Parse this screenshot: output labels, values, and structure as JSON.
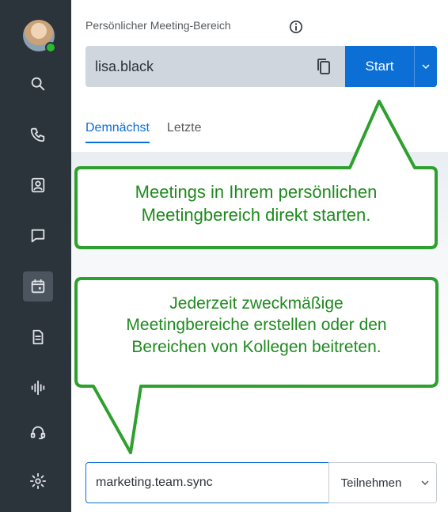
{
  "sidebar": {
    "items": [
      {
        "name": "search",
        "icon": "search-icon"
      },
      {
        "name": "calls",
        "icon": "phone-icon"
      },
      {
        "name": "contacts",
        "icon": "contacts-icon"
      },
      {
        "name": "messaging",
        "icon": "chat-icon"
      },
      {
        "name": "meetings",
        "icon": "calendar-icon",
        "active": true
      },
      {
        "name": "voicemail",
        "icon": "document-icon"
      },
      {
        "name": "analytics",
        "icon": "waveform-icon"
      },
      {
        "name": "help",
        "icon": "headset-icon"
      },
      {
        "name": "settings",
        "icon": "gear-icon"
      }
    ],
    "presence_color": "#2eb82e"
  },
  "pmr": {
    "title": "Persönlicher Meeting-Bereich",
    "name": "lisa.black",
    "start_label": "Start"
  },
  "tabs": [
    {
      "label": "Demnächst",
      "active": true
    },
    {
      "label": "Letzte",
      "active": false
    }
  ],
  "join": {
    "value": "marketing.team.sync",
    "button_label": "Teilnehmen"
  },
  "callouts": {
    "top_line1": "Meetings in Ihrem persönlichen",
    "top_line2": "Meetingbereich direkt starten.",
    "bottom_line1": "Jederzeit zweckmäßige",
    "bottom_line2": "Meetingbereiche erstellen oder den",
    "bottom_line3": "Bereichen von Kollegen beitreten."
  },
  "colors": {
    "accent": "#0b6fd6",
    "sidebar": "#2b333b",
    "callout_border": "#2ea02e",
    "callout_text": "#1e8a1e"
  }
}
